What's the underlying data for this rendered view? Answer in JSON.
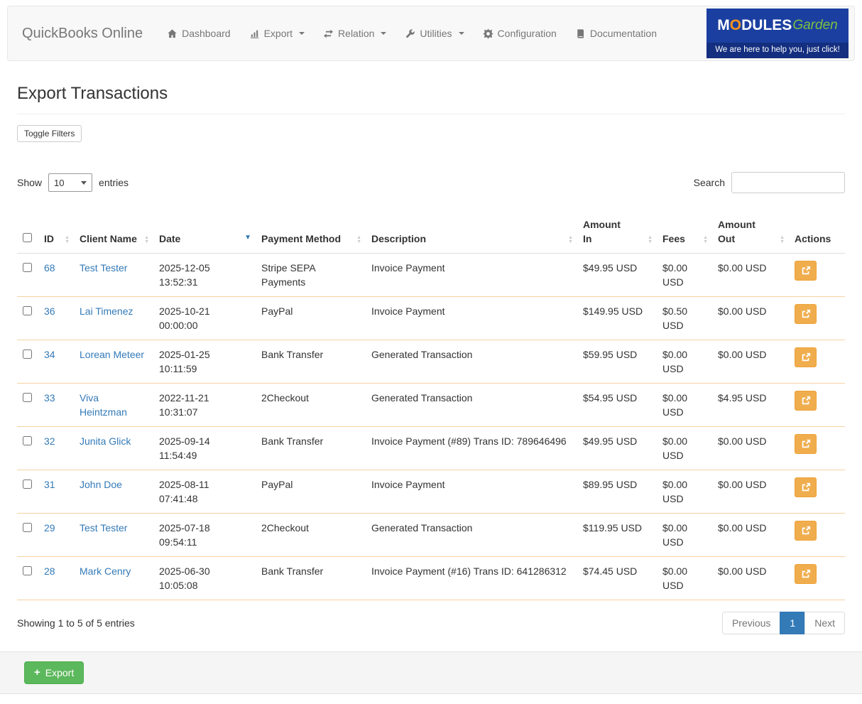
{
  "navbar": {
    "brand": "QuickBooks Online",
    "items": [
      {
        "label": "Dashboard"
      },
      {
        "label": "Export"
      },
      {
        "label": "Relation"
      },
      {
        "label": "Utilities"
      },
      {
        "label": "Configuration"
      },
      {
        "label": "Documentation"
      }
    ],
    "logo": {
      "m": "M",
      "o": "O",
      "odules": "DULES",
      "garden": "Garden",
      "tagline": "We are here to help you, just click!"
    }
  },
  "page": {
    "title": "Export Transactions",
    "toggle_filters_label": "Toggle Filters"
  },
  "controls": {
    "show_label": "Show",
    "page_size": "10",
    "entries_label": "entries",
    "search_label": "Search",
    "search_value": ""
  },
  "table": {
    "columns": [
      {
        "label": "ID",
        "sort": "both"
      },
      {
        "label": "Client Name",
        "sort": "both"
      },
      {
        "label": "Date",
        "sort": "desc"
      },
      {
        "label": "Payment Method",
        "sort": "both"
      },
      {
        "label": "Description",
        "sort": "both"
      },
      {
        "label": "Amount In",
        "sort": "both"
      },
      {
        "label": "Fees",
        "sort": "both"
      },
      {
        "label": "Amount Out",
        "sort": "both"
      },
      {
        "label": "Actions",
        "sort": "none"
      }
    ],
    "rows": [
      {
        "id": "68",
        "client": "Test Tester",
        "date": "2025-12-05 13:52:31",
        "method": "Stripe SEPA Payments",
        "description": "Invoice Payment",
        "amount_in": "$49.95 USD",
        "fees": "$0.00 USD",
        "amount_out": "$0.00 USD"
      },
      {
        "id": "36",
        "client": "Lai Timenez",
        "date": "2025-10-21 00:00:00",
        "method": "PayPal",
        "description": "Invoice Payment",
        "amount_in": "$149.95 USD",
        "fees": "$0.50 USD",
        "amount_out": "$0.00 USD"
      },
      {
        "id": "34",
        "client": "Lorean Meteer",
        "date": "2025-01-25 10:11:59",
        "method": "Bank Transfer",
        "description": "Generated Transaction",
        "amount_in": "$59.95 USD",
        "fees": "$0.00 USD",
        "amount_out": "$0.00 USD"
      },
      {
        "id": "33",
        "client": "Viva Heintzman",
        "date": "2022-11-21 10:31:07",
        "method": "2Checkout",
        "description": "Generated Transaction",
        "amount_in": "$54.95 USD",
        "fees": "$0.00 USD",
        "amount_out": "$4.95 USD"
      },
      {
        "id": "32",
        "client": "Junita Glick",
        "date": "2025-09-14 11:54:49",
        "method": "Bank Transfer",
        "description": "Invoice Payment (#89) Trans ID: 789646496",
        "amount_in": "$49.95 USD",
        "fees": "$0.00 USD",
        "amount_out": "$0.00 USD"
      },
      {
        "id": "31",
        "client": "John Doe",
        "date": "2025-08-11 07:41:48",
        "method": "PayPal",
        "description": "Invoice Payment",
        "amount_in": "$89.95 USD",
        "fees": "$0.00 USD",
        "amount_out": "$0.00 USD"
      },
      {
        "id": "29",
        "client": "Test Tester",
        "date": "2025-07-18 09:54:11",
        "method": "2Checkout",
        "description": "Generated Transaction",
        "amount_in": "$119.95 USD",
        "fees": "$0.00 USD",
        "amount_out": "$0.00 USD"
      },
      {
        "id": "28",
        "client": "Mark Cenry",
        "date": "2025-06-30 10:05:08",
        "method": "Bank Transfer",
        "description": "Invoice Payment (#16) Trans ID: 641286312",
        "amount_in": "$74.45 USD",
        "fees": "$0.00 USD",
        "amount_out": "$0.00 USD"
      }
    ]
  },
  "footer": {
    "showing_text": "Showing 1 to 5 of 5 entries",
    "pagination": {
      "previous": "Previous",
      "page": "1",
      "next": "Next"
    },
    "export_label": "Export"
  },
  "colors": {
    "link": "#337ab7",
    "row_border": "#f7d3a2",
    "action_button": "#f0ad4e",
    "export_button": "#5cb85c",
    "active_page": "#337ab7",
    "navbar_bg": "#f8f8f8",
    "logo_bg": "#1b3fa0",
    "logo_garden_green": "#7ac143",
    "logo_o_orange": "#f7941d"
  }
}
